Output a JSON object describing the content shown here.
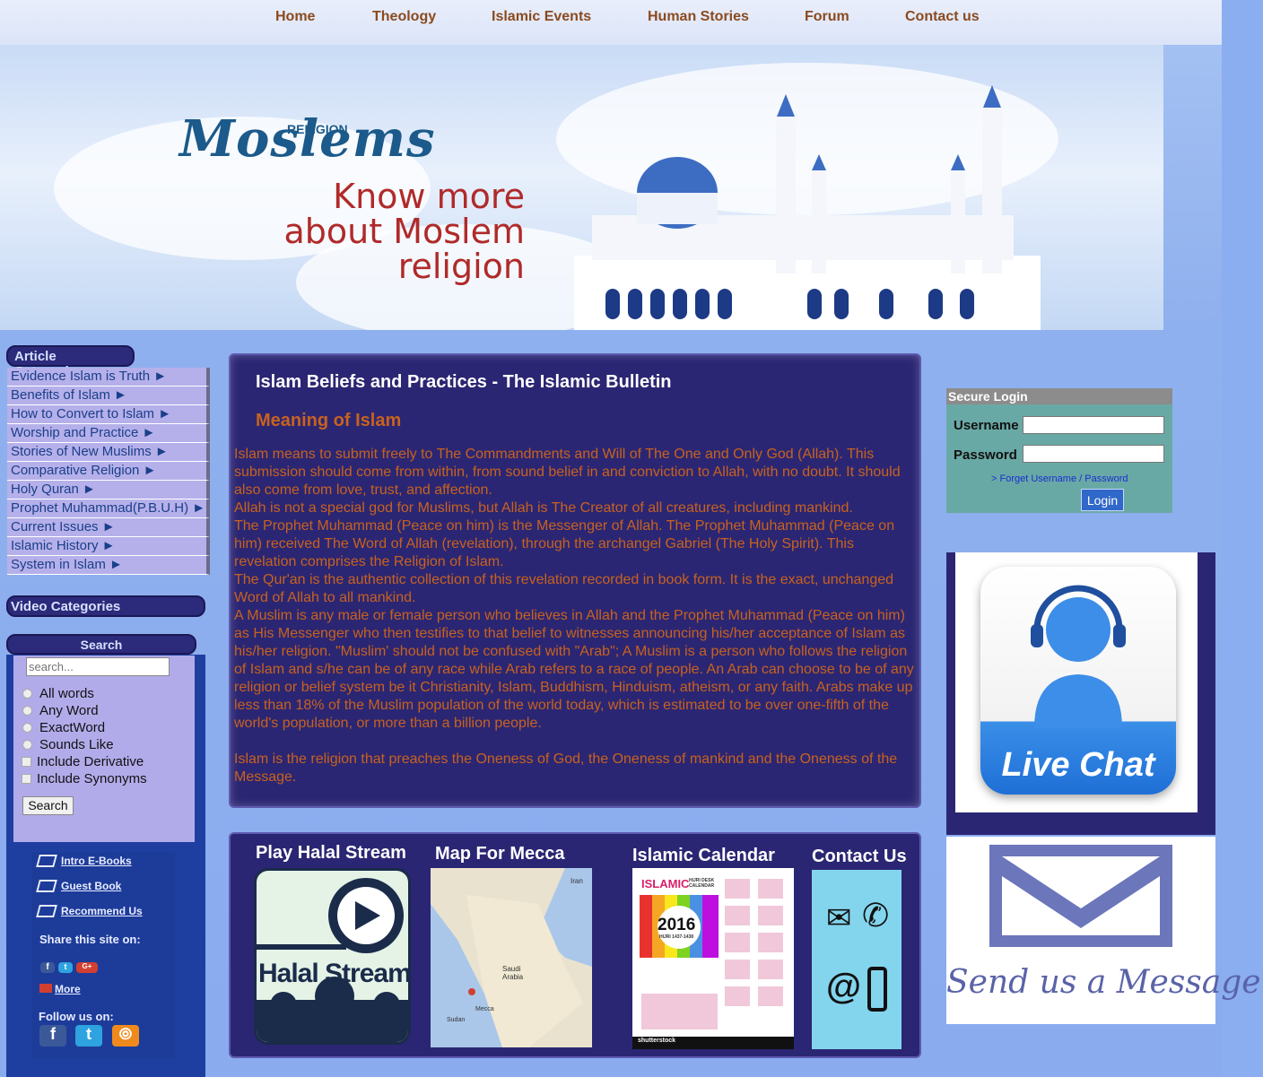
{
  "nav": [
    "Home",
    "Theology",
    "Islamic Events",
    "Human Stories",
    "Forum",
    "Contact us"
  ],
  "banner": {
    "logo": "Moslems",
    "logo_sub": "RELIGION",
    "tagline": [
      "Know more",
      "about Moslem",
      "religion"
    ]
  },
  "sidebar": {
    "article_categories_title": "Article Categories",
    "categories": [
      "Evidence Islam is Truth ►",
      "Benefits of Islam ►",
      "How to Convert to Islam ►",
      "Worship and Practice ►",
      "Stories of New Muslims ►",
      "Comparative Religion ►",
      "Holy Quran ►",
      "Prophet Muhammad(P.B.U.H) ►",
      "Current Issues ►",
      "Islamic History ►",
      "System in Islam ►"
    ],
    "video_categories_title": "Video Categories",
    "search_title": "Search",
    "search_placeholder": "search...",
    "radio_options": [
      "All words",
      "Any Word",
      "ExactWord",
      "Sounds Like"
    ],
    "checkbox_options": [
      "Include Derivative",
      "Include Synonyms"
    ],
    "search_button": "Search",
    "links": [
      "Intro E-Books",
      "Guest Book",
      "Recommend Us"
    ],
    "share_text": "Share this site on:",
    "more": "More",
    "follow_text": "Follow us on:"
  },
  "article": {
    "title": "Islam Beliefs and Practices - The Islamic Bulletin",
    "subtitle": "Meaning of Islam",
    "paragraphs": [
      "Islam means to submit freely to The Commandments and Will of The One and Only God (Allah). This submission should come from within, from sound belief in and conviction to Allah, with no doubt. It should also come from love, trust, and affection.",
      "Allah is not a special god for Muslims, but Allah is The Creator of all creatures, including mankind.",
      "The Prophet Muhammad (Peace on him) is the Messenger of Allah. The Prophet Muhammad (Peace on him) received The Word of Allah (revelation), through the archangel Gabriel (The Holy Spirit). This revelation comprises the Religion of Islam.",
      "The Qur'an is the authentic collection of this revelation recorded in book form. It is the exact, unchanged Word of Allah to all mankind.",
      "A Muslim is any male or female person who believes in Allah and the Prophet Muhammad (Peace on him) as His Messenger who then testifies to that belief to witnesses announcing his/her acceptance of Islam as his/her religion. \"Muslim' should not be confused with \"Arab\"; A Muslim is a person who follows the religion of Islam and s/he can be of any race while Arab refers to a race of people. An Arab can choose to be of any religion or belief system be it Christianity, Islam, Buddhism, Hinduism, atheism, or any faith. Arabs make up less than 18% of the Muslim population of the world today, which is estimated to be over one-fifth of the world's population, or more than a billion people.",
      "Islam is the religion that preaches the Oneness of God, the Oneness of mankind and the Oneness of the Message."
    ]
  },
  "bottom": {
    "halal_title": "Play Halal Stream",
    "halal_label": "Halal Stream",
    "map_title": "Map For Mecca",
    "map_labels": [
      "Iran",
      "Saudi Arabia",
      "Mecca",
      "Sudan"
    ],
    "calendar_title": "Islamic Calendar",
    "calendar_labels": [
      "ISLAMIC",
      "HIJRI DESK CALENDAR",
      "2016",
      "HIJRI 1437-1438",
      "shutterstock"
    ],
    "contact_title": "Contact Us"
  },
  "login": {
    "title": "Secure Login",
    "username_label": "Username",
    "password_label": "Password",
    "forgot": "> Forget Username / Password",
    "button": "Login"
  },
  "live_chat": "Live Chat",
  "send_message": "Send us a Message.",
  "colors": {
    "nav_text": "#8a4a1e",
    "article_bg": "#2b2673",
    "article_text": "#c8621e",
    "category_bg": "#b5b0ea"
  }
}
